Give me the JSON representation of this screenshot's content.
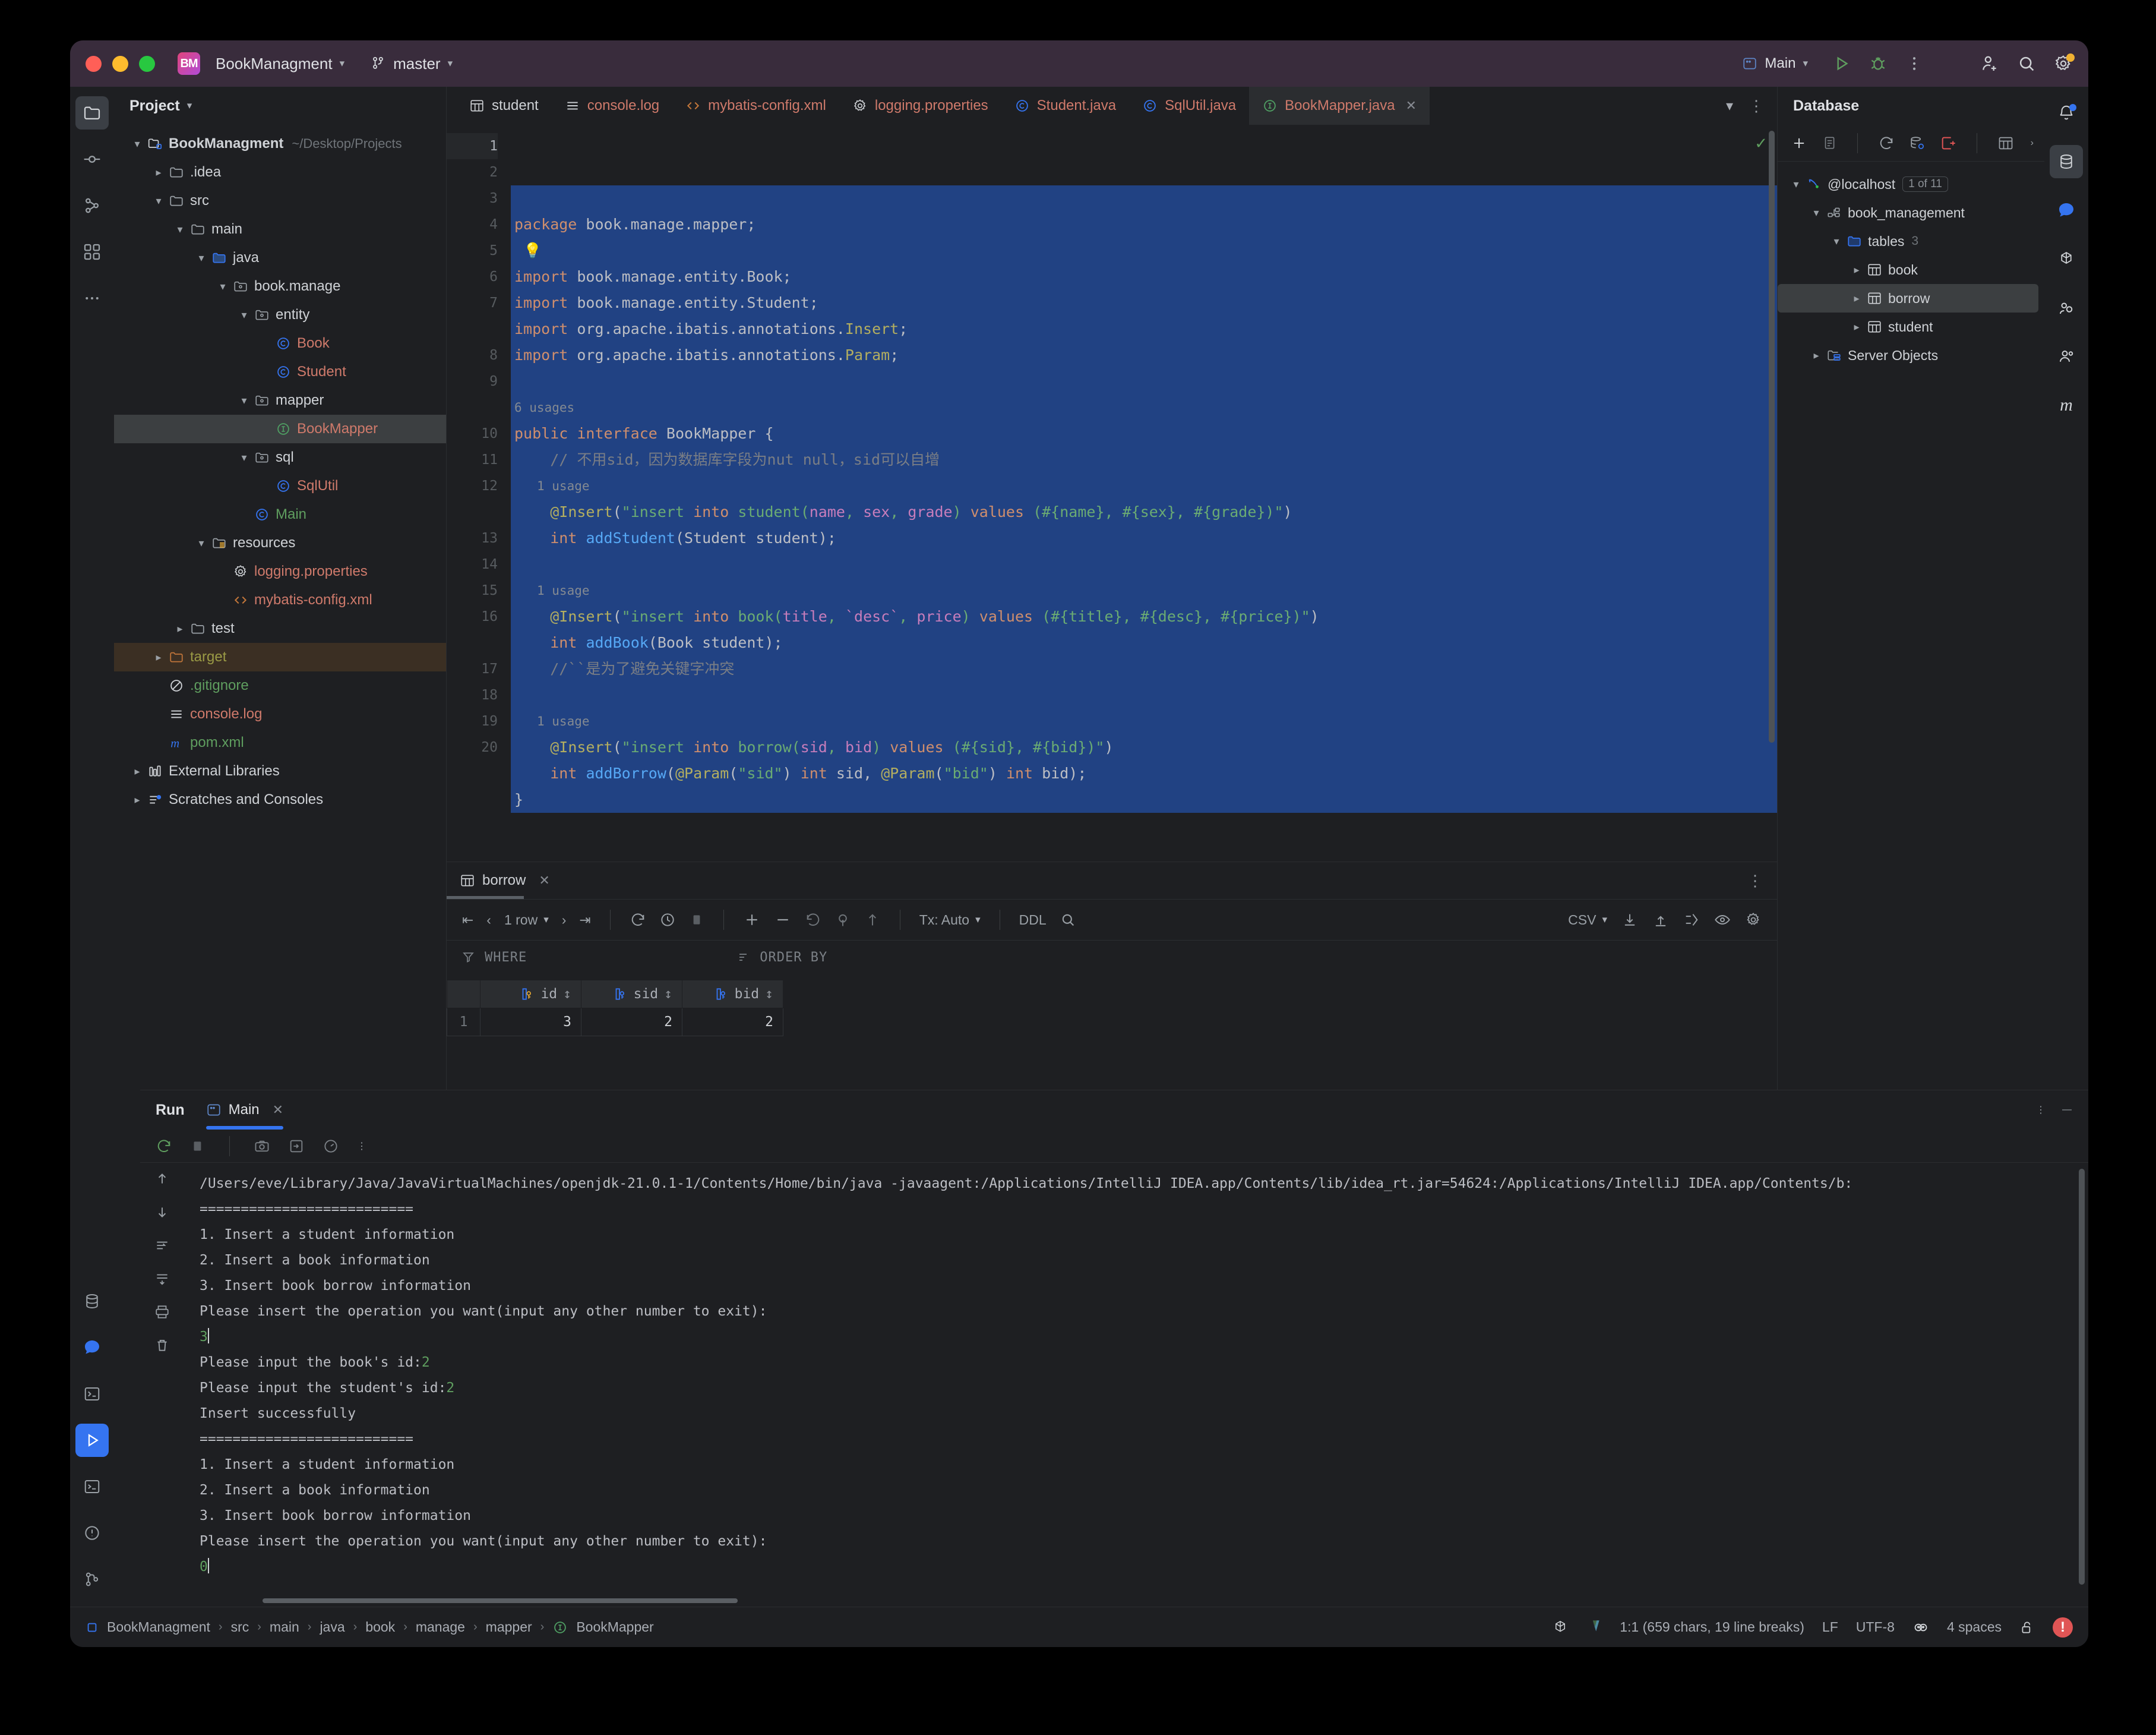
{
  "window": {
    "project_badge": "BM",
    "project_name": "BookManagment",
    "branch": "master",
    "run_config": "Main"
  },
  "project_panel": {
    "title": "Project",
    "tree": [
      {
        "label": "BookManagment",
        "path": "~/Desktop/Projects",
        "icon": "module-icon",
        "depth": 0,
        "arrow": "down",
        "color": "white",
        "bold": true
      },
      {
        "label": ".idea",
        "icon": "folder-icon",
        "depth": 1,
        "arrow": "right",
        "color": "white"
      },
      {
        "label": "src",
        "icon": "folder-icon",
        "depth": 1,
        "arrow": "down",
        "color": "white"
      },
      {
        "label": "main",
        "icon": "folder-icon",
        "depth": 2,
        "arrow": "down",
        "color": "white"
      },
      {
        "label": "java",
        "icon": "source-folder-icon",
        "depth": 3,
        "arrow": "down",
        "color": "white"
      },
      {
        "label": "book.manage",
        "icon": "package-icon",
        "depth": 4,
        "arrow": "down",
        "color": "white"
      },
      {
        "label": "entity",
        "icon": "package-icon",
        "depth": 5,
        "arrow": "down",
        "color": "white"
      },
      {
        "label": "Book",
        "icon": "class-icon",
        "depth": 6,
        "arrow": "none",
        "color": "red"
      },
      {
        "label": "Student",
        "icon": "class-icon",
        "depth": 6,
        "arrow": "none",
        "color": "red"
      },
      {
        "label": "mapper",
        "icon": "package-icon",
        "depth": 5,
        "arrow": "down",
        "color": "white"
      },
      {
        "label": "BookMapper",
        "icon": "interface-icon",
        "depth": 6,
        "arrow": "none",
        "color": "red",
        "selected": true
      },
      {
        "label": "sql",
        "icon": "package-icon",
        "depth": 5,
        "arrow": "down",
        "color": "white"
      },
      {
        "label": "SqlUtil",
        "icon": "class-icon",
        "depth": 6,
        "arrow": "none",
        "color": "red"
      },
      {
        "label": "Main",
        "icon": "class-icon",
        "depth": 5,
        "arrow": "none",
        "color": "green"
      },
      {
        "label": "resources",
        "icon": "resource-folder-icon",
        "depth": 3,
        "arrow": "down",
        "color": "white"
      },
      {
        "label": "logging.properties",
        "icon": "properties-icon",
        "depth": 4,
        "arrow": "none",
        "color": "red"
      },
      {
        "label": "mybatis-config.xml",
        "icon": "xml-icon",
        "depth": 4,
        "arrow": "none",
        "color": "red"
      },
      {
        "label": "test",
        "icon": "folder-icon",
        "depth": 2,
        "arrow": "right",
        "color": "white"
      },
      {
        "label": "target",
        "icon": "excluded-folder-icon",
        "depth": 1,
        "arrow": "right",
        "color": "yellow",
        "target": true
      },
      {
        "label": ".gitignore",
        "icon": "gitignore-icon",
        "depth": 1,
        "arrow": "none",
        "color": "green"
      },
      {
        "label": "console.log",
        "icon": "log-icon",
        "depth": 1,
        "arrow": "none",
        "color": "red"
      },
      {
        "label": "pom.xml",
        "icon": "maven-icon",
        "depth": 1,
        "arrow": "none",
        "color": "green"
      },
      {
        "label": "External Libraries",
        "icon": "libraries-icon",
        "depth": 0,
        "arrow": "right",
        "color": "white"
      },
      {
        "label": "Scratches and Consoles",
        "icon": "scratches-icon",
        "depth": 0,
        "arrow": "right",
        "color": "white"
      }
    ]
  },
  "editor_tabs": [
    {
      "label": "student",
      "icon": "table-icon",
      "color": "plain"
    },
    {
      "label": "console.log",
      "icon": "log-icon",
      "color": "red"
    },
    {
      "label": "mybatis-config.xml",
      "icon": "xml-icon",
      "color": "red"
    },
    {
      "label": "logging.properties",
      "icon": "properties-icon",
      "color": "red"
    },
    {
      "label": "Student.java",
      "icon": "class-icon",
      "color": "red"
    },
    {
      "label": "SqlUtil.java",
      "icon": "class-icon",
      "color": "red"
    },
    {
      "label": "BookMapper.java",
      "icon": "interface-icon",
      "color": "red",
      "active": true,
      "closable": true
    }
  ],
  "editor": {
    "filename": "BookMapper.java",
    "line_numbers": [
      "1",
      "2",
      "3",
      "4",
      "5",
      "6",
      "7",
      "8",
      "9",
      "10",
      "11",
      "12",
      "13",
      "14",
      "15",
      "16",
      "17",
      "18",
      "19",
      "20"
    ],
    "lines": [
      "package book.manage.mapper;",
      "",
      "import book.manage.entity.Book;",
      "import book.manage.entity.Student;",
      "import org.apache.ibatis.annotations.Insert;",
      "import org.apache.ibatis.annotations.Param;",
      "",
      "public interface BookMapper {",
      "    // 不用sid，因为数据库字段为nut null，sid可以自增",
      "    @Insert(\"insert into student(name, sex, grade) values (#{name}, #{sex}, #{grade})\")",
      "    int addStudent(Student student);",
      "",
      "    @Insert(\"insert into book(title, `desc`, price) values (#{title}, #{desc}, #{price})\")",
      "    int addBook(Book student);",
      "    //``是为了避免关键字冲突",
      "",
      "    @Insert(\"insert into borrow(sid, bid) values (#{sid}, #{bid})\")",
      "    int addBorrow(@Param(\"sid\") int sid, @Param(\"bid\") int bid);",
      "}",
      ""
    ],
    "inlay_hints": {
      "interface_usages": "6 usages",
      "method1_usages": "1 usage",
      "method2_usages": "1 usage",
      "method3_usages": "1 usage"
    }
  },
  "data_grid": {
    "tab_label": "borrow",
    "row_count_label": "1 row",
    "tx_label": "Tx: Auto",
    "ddl_label": "DDL",
    "csv_label": "CSV",
    "where_label": "WHERE",
    "order_by_label": "ORDER BY",
    "columns": [
      "id",
      "sid",
      "bid"
    ],
    "rows": [
      {
        "num": "1",
        "id": "3",
        "sid": "2",
        "bid": "2"
      }
    ]
  },
  "database_panel": {
    "title": "Database",
    "tree": [
      {
        "label": "@localhost",
        "badge": "1 of 11",
        "icon": "datasource-icon",
        "depth": 0,
        "arrow": "down"
      },
      {
        "label": "book_management",
        "icon": "schema-icon",
        "depth": 1,
        "arrow": "down"
      },
      {
        "label": "tables",
        "count": "3",
        "icon": "folder-blue-icon",
        "depth": 2,
        "arrow": "down"
      },
      {
        "label": "book",
        "icon": "table-icon",
        "depth": 3,
        "arrow": "right"
      },
      {
        "label": "borrow",
        "icon": "table-icon",
        "depth": 3,
        "arrow": "right",
        "selected": true
      },
      {
        "label": "student",
        "icon": "table-icon",
        "depth": 3,
        "arrow": "right"
      },
      {
        "label": "Server Objects",
        "icon": "server-objects-icon",
        "depth": 1,
        "arrow": "right"
      }
    ]
  },
  "run_window": {
    "title": "Run",
    "tab_label": "Main",
    "console_lines": [
      {
        "text": "/Users/eve/Library/Java/JavaVirtualMachines/openjdk-21.0.1-1/Contents/Home/bin/java -javaagent:/Applications/IntelliJ IDEA.app/Contents/lib/idea_rt.jar=54624:/Applications/IntelliJ IDEA.app/Contents/b:"
      },
      {
        "text": "=========================="
      },
      {
        "text": "1. Insert a student information"
      },
      {
        "text": "2. Insert a book information"
      },
      {
        "text": "3. Insert book borrow information"
      },
      {
        "text": "Please insert the operation you want(input any other number to exit):"
      },
      {
        "text": "3",
        "style": "input"
      },
      {
        "text": "Please input the book's id:",
        "suffix": "2"
      },
      {
        "text": "Please input the student's id:",
        "suffix": "2"
      },
      {
        "text": "Insert successfully"
      },
      {
        "text": "=========================="
      },
      {
        "text": "1. Insert a student information"
      },
      {
        "text": "2. Insert a book information"
      },
      {
        "text": "3. Insert book borrow information"
      },
      {
        "text": "Please insert the operation you want(input any other number to exit):"
      },
      {
        "text": "0",
        "style": "input"
      }
    ]
  },
  "status_bar": {
    "breadcrumbs": [
      "BookManagment",
      "src",
      "main",
      "java",
      "book",
      "manage",
      "mapper",
      "BookMapper"
    ],
    "caret": "1:1 (659 chars, 19 line breaks)",
    "line_separator": "LF",
    "encoding": "UTF-8",
    "indent": "4 spaces"
  },
  "colors": {
    "accent_blue": "#3574f0",
    "selection_blue": "#214283",
    "error_red": "#e05555",
    "run_green": "#5f9e5f",
    "titlebar": "#392c3c",
    "panel_bg": "#1e1f22"
  }
}
